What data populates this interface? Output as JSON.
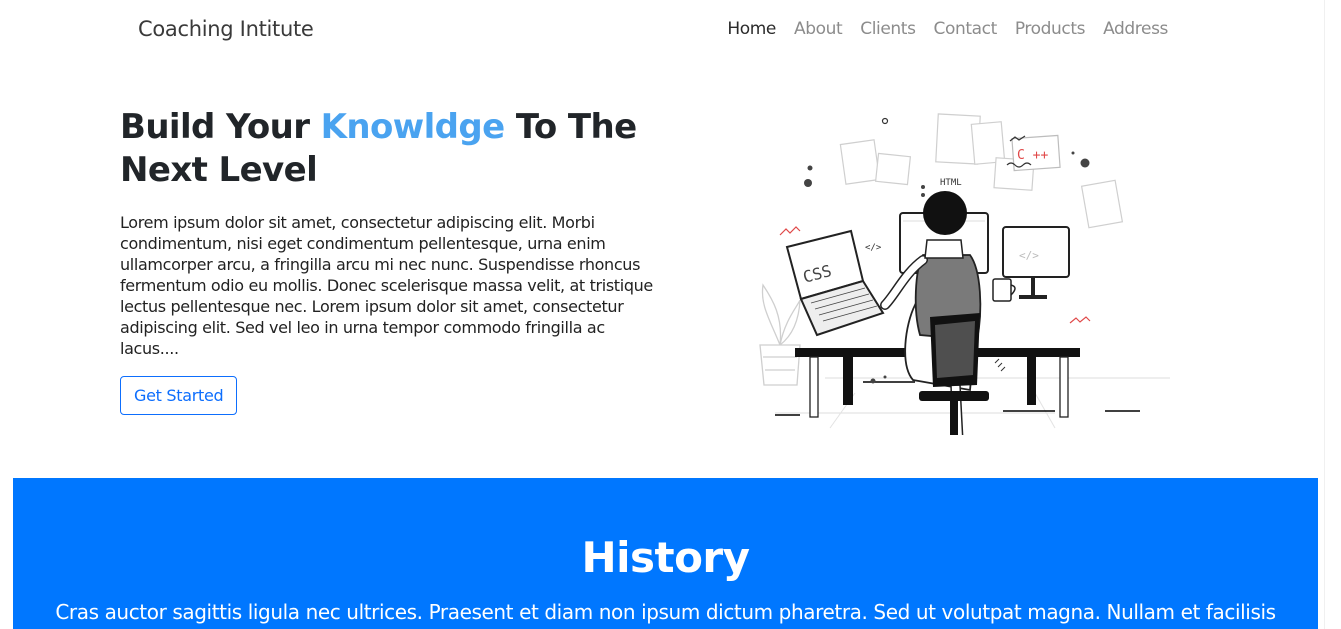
{
  "navbar": {
    "brand": "Coaching Intitute",
    "links": [
      "Home",
      "About",
      "Clients",
      "Contact",
      "Products",
      "Address"
    ]
  },
  "hero": {
    "title_part1": "Build Your ",
    "title_accent": "Knowldge",
    "title_part2": " To The Next Level",
    "description": "Lorem ipsum dolor sit amet, consectetur adipiscing elit. Morbi condimentum, nisi eget condimentum pellentesque, urna enim ullamcorper arcu, a fringilla arcu mi nec nunc. Suspendisse rhoncus fermentum odio eu mollis. Donec scelerisque massa velit, at tristique lectus pellentesque nec. Lorem ipsum dolor sit amet, consectetur adipiscing elit. Sed vel leo in urna tempor commodo fringilla ac lacus....",
    "cta_label": "Get Started",
    "illustration": {
      "laptop_text": "CSS",
      "note_html": "HTML",
      "note_cpp": "C ++",
      "code_tag": "</>",
      "code_tag_alt": "</>"
    }
  },
  "history": {
    "title": "History",
    "text": "Cras auctor sagittis ligula nec ultrices. Praesent et diam non ipsum dictum pharetra. Sed ut volutpat magna. Nullam et facilisis"
  },
  "colors": {
    "accent": "#4aa3f0",
    "primary": "#0d6efd",
    "history_bg": "#0077ff"
  }
}
